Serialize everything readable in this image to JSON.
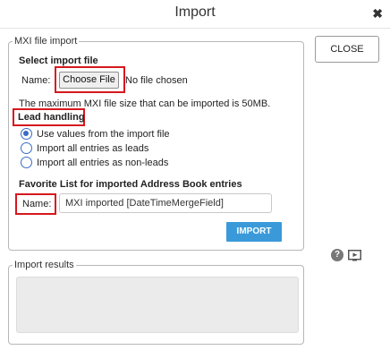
{
  "dialog": {
    "title": "Import",
    "close_glyph": "✖"
  },
  "mxi_import": {
    "legend": "MXI file import",
    "select_file_heading": "Select import file",
    "name_label": "Name:",
    "choose_file_label": "Choose File",
    "no_file_text": "No file chosen",
    "max_size_text": "The maximum MXI file size that can be imported is 50MB."
  },
  "lead_handling": {
    "heading": "Lead handling",
    "options": [
      {
        "label": "Use values from the import file",
        "checked": true
      },
      {
        "label": "Import all entries as leads",
        "checked": false
      },
      {
        "label": "Import all entries as non-leads",
        "checked": false
      }
    ]
  },
  "favorite_list": {
    "heading": "Favorite List for imported Address Book entries",
    "name_label": "Name:",
    "name_value": "MXI imported [DateTimeMergeField]"
  },
  "buttons": {
    "import_label": "IMPORT",
    "close_label": "CLOSE"
  },
  "icons": {
    "help": "help-icon",
    "video": "video-icon",
    "help_glyph": "?"
  },
  "results": {
    "legend": "Import results"
  },
  "colors": {
    "highlight": "#d6181e",
    "primary_button": "#3a9ad9",
    "radio_accent": "#3a6cc4"
  }
}
